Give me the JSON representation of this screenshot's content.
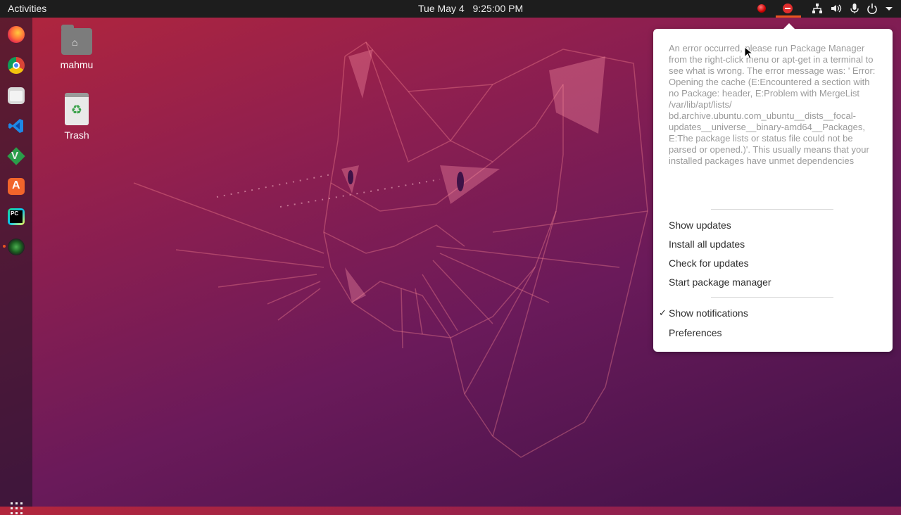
{
  "topbar": {
    "activities": "Activities",
    "date": "Tue May 4",
    "time": "9:25:00 PM"
  },
  "tray_icons": [
    "record-indicator-icon",
    "update-error-icon",
    "network-icon",
    "volume-icon",
    "microphone-icon",
    "power-icon",
    "chevron-down-icon"
  ],
  "dock": {
    "apps": [
      "firefox",
      "chrome",
      "files",
      "vscode",
      "vim",
      "ubuntu-software",
      "pycharm",
      "camera"
    ]
  },
  "desktop": {
    "home_label": "mahmu",
    "trash_label": "Trash"
  },
  "popup": {
    "error_message": "An error occurred, please run Package Manager from the right-click menu or apt-get in a terminal to see what is wrong. The error message was: ' Error: Opening the cache (E:Encountered a section with no Package: header, E:Problem with MergeList /var/lib/apt/lists/ bd.archive.ubuntu.com_ubuntu__dists__focal-updates__universe__binary-amd64__Packages, E:The package lists or status file could not be parsed or opened.)'. This usually means that your installed packages have unmet dependencies",
    "items": {
      "show_updates": "Show updates",
      "install_all": "Install all updates",
      "check_updates": "Check for updates",
      "start_pkg_mgr": "Start package manager",
      "show_notifications": "Show notifications",
      "preferences": "Preferences"
    },
    "checkmark": "✓"
  },
  "colors": {
    "accent": "#e95420",
    "topbar": "#1d1d1d",
    "popup_bg": "#ffffff",
    "error_text": "#9a9a9a"
  }
}
